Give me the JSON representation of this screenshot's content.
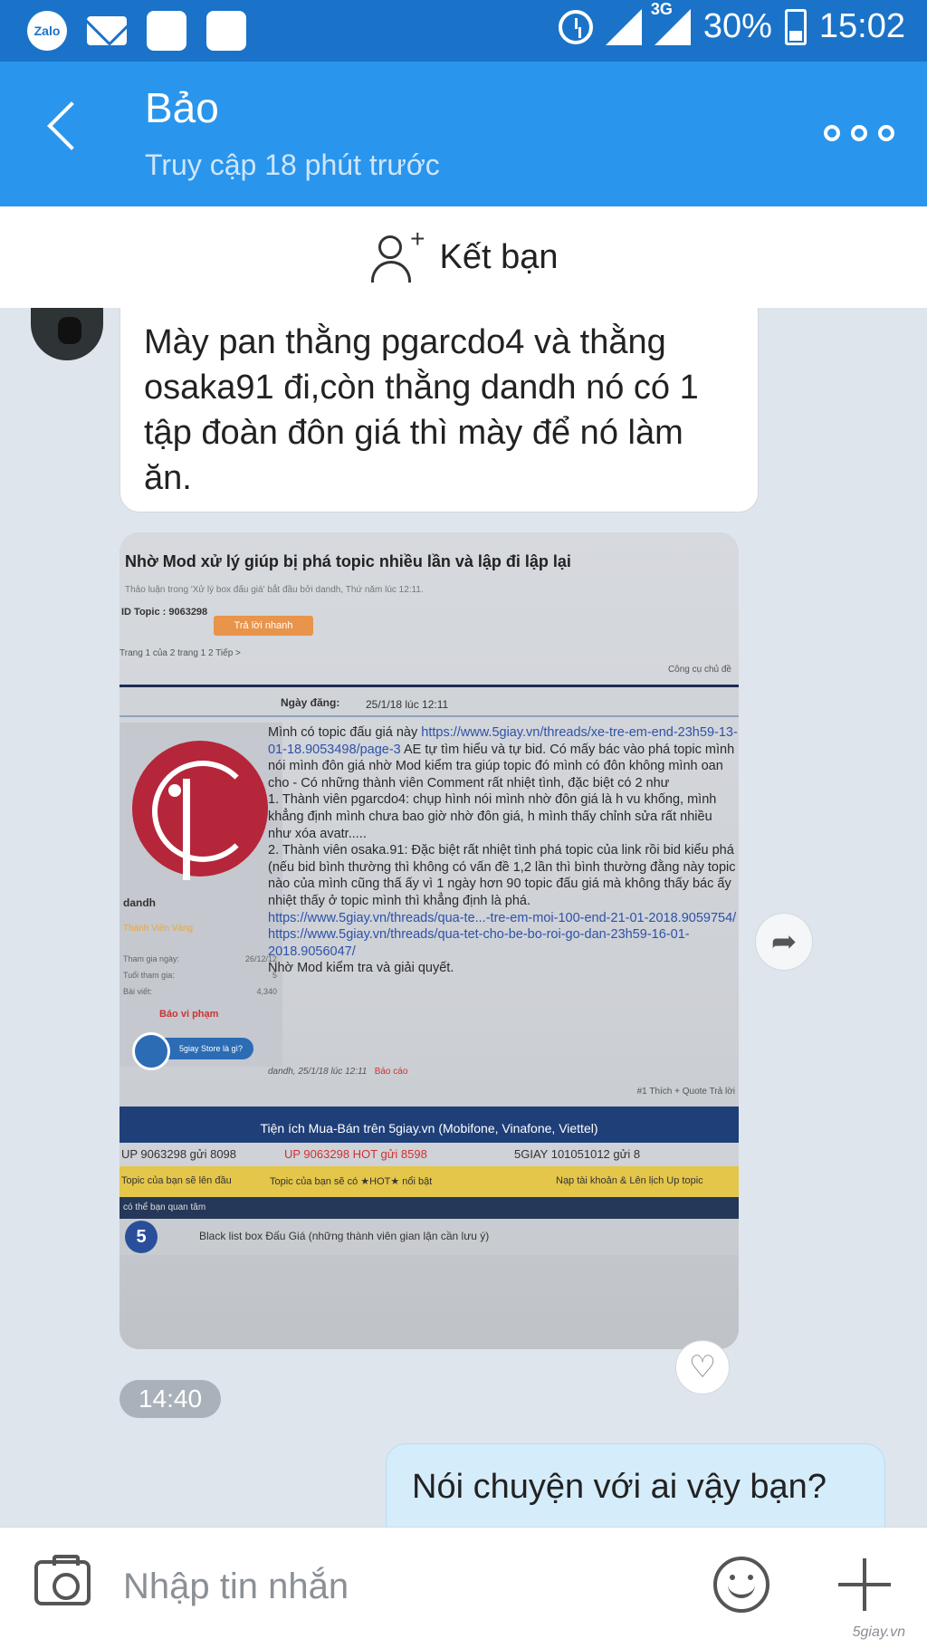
{
  "status_bar": {
    "app_badge": "Zalo",
    "network": "3G",
    "battery": "30%",
    "time": "15:02"
  },
  "header": {
    "contact_name": "Bảo",
    "last_seen": "Truy cập 18 phút trước"
  },
  "friend_bar": {
    "label": "Kết bạn"
  },
  "messages": {
    "incoming_text": "Mày pan thằng pgarcdo4 và thằng osaka91 đi,còn thằng dandh nó có 1 tập đoàn đôn giá thì mày để nó làm ăn.",
    "time_badge": "14:40",
    "outgoing_text": "Nói chuyện với ai vậy bạn?"
  },
  "screenshot_doc": {
    "title": "Nhờ Mod xử lý giúp bị phá topic nhiều lần và lập đi lập lại",
    "subtitle": "Thảo luận trong 'Xử lý box đấu giá' bắt đầu bởi dandh, Thứ năm lúc 12:11.",
    "topic_id": "ID Topic : 9063298",
    "reply_button": "Trả lời nhanh",
    "pages": "Trang 1 của 2 trang  1  2  Tiếp >",
    "tools": "Công cụ chủ đề",
    "date_label": "Ngày đăng:",
    "date_value": "25/1/18 lúc 12:11",
    "username": "dandh",
    "rank": "Thành Viên Vàng",
    "stat1_label": "Tham gia ngày:",
    "stat1_value": "26/12/12",
    "stat2_label": "Tuổi tham gia:",
    "stat2_value": "5",
    "stat3_label": "Bài viết:",
    "stat3_value": "4,340",
    "report": "Báo vi phạm",
    "store": "5giay Store là gì?",
    "post_p1": "Mình có topic đấu giá này ",
    "post_link1": "https://www.5giay.vn/threads/xe-tre-em-end-23h59-13-01-18.9053498/page-3",
    "post_p2": " AE tự tìm hiểu và tự bid. Có mấy bác vào phá topic mình nói mình đôn giá nhờ Mod kiểm tra giúp topic đó mình có đôn không mình oan cho - Có những thành viên Comment rất nhiệt tình, đặc biệt có 2 như\n1. Thành viên pgarcdo4: chụp hình nói mình nhờ đôn giá là h vu khống, mình khẳng định mình chưa bao giờ nhờ đôn giá, h mình thấy chỉnh sửa rất nhiều như xóa avatr.....\n2. Thành viên osaka.91: Đặc biệt rất nhiệt tình phá topic của link rồi bid kiểu phá (nếu bid bình thường thì không có vấn đề 1,2 lần thì bình thường đằng này topic nào của mình cũng thấ ấy vì 1 ngày hơn 90 topic đấu giá mà không thấy bác ấy nhiệt thấy ở topic mình thì khẳng định là phá.\n",
    "post_link2": "https://www.5giay.vn/threads/qua-te...-tre-em-moi-100-end-21-01-2018.9059754/",
    "post_link3": "https://www.5giay.vn/threads/qua-tet-cho-be-bo-roi-go-dan-23h59-16-01-2018.9056047/",
    "post_end": "Nhờ Mod kiểm tra và giải quyết.",
    "footer_meta": "dandh, 25/1/18 lúc 12:11",
    "footer_report": "Báo cáo",
    "likes": "#1  Thích  + Quote  Trả lời",
    "banner": "Tiện ích Mua-Bán trên 5giay.vn (Mobifone, Vinafone, Viettel)",
    "up1": "UP 9063298 gửi 8098",
    "up2": "UP 9063298 HOT gửi 8598",
    "up3": "5GIAY 101051012 gửi 8",
    "y1": "Topic của bạn sẽ lên đầu",
    "y2": "Topic của bạn sẽ có ★HOT★ nổi bật",
    "y3": "Nạp tài khoản & Lên lịch Up topic",
    "dark": "có thể bạn quan tâm",
    "bl_num": "5",
    "blacklist": "Black list box Đấu Giá (những thành viên gian lận cần lưu ý)"
  },
  "input_bar": {
    "placeholder": "Nhập tin nhắn"
  },
  "watermark": "5giay.vn",
  "colors": {
    "header_bg": "#2a95ec",
    "status_bg": "#1a73c8",
    "chat_bg": "#dfe5ec",
    "outgoing_bubble": "#d5ecfb"
  }
}
